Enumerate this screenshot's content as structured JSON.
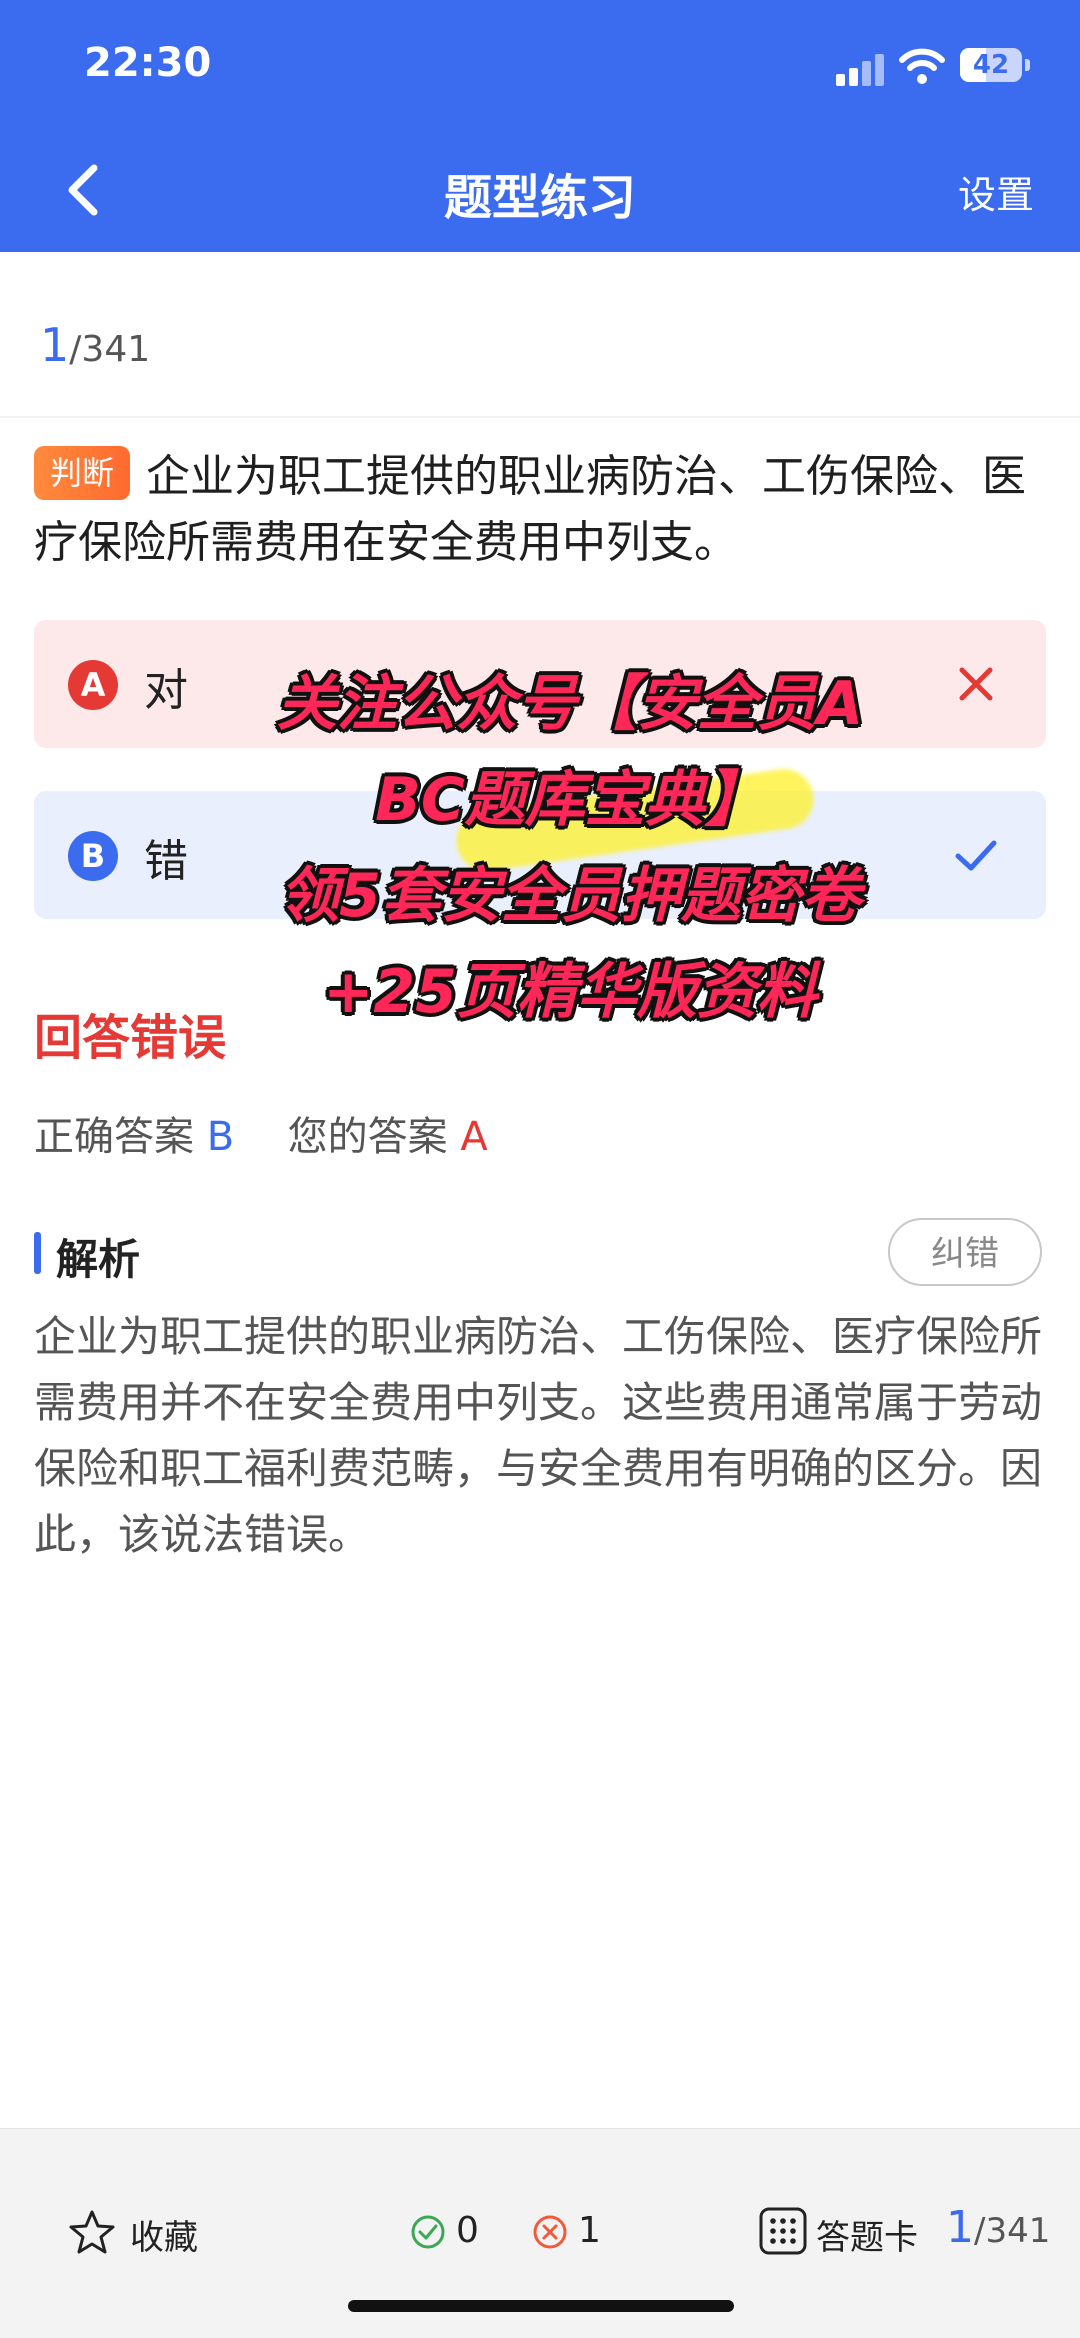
{
  "status_bar": {
    "time": "22:30",
    "battery": "42"
  },
  "nav": {
    "title": "题型练习",
    "settings_label": "设置"
  },
  "progress": {
    "current": "1",
    "total": "/341"
  },
  "question": {
    "tag": "判断",
    "text": "企业为职工提供的职业病防治、工伤保险、医疗保险所需费用在安全费用中列支。"
  },
  "options": [
    {
      "letter": "A",
      "label": "对",
      "state": "wrong"
    },
    {
      "letter": "B",
      "label": "错",
      "state": "correct"
    }
  ],
  "result": {
    "title": "回答错误",
    "correct_label": "正确答案",
    "correct_value": "B",
    "yours_label": "您的答案",
    "yours_value": "A"
  },
  "analysis": {
    "title": "解析",
    "report_label": "纠错",
    "text": "企业为职工提供的职业病防治、工伤保险、医疗保险所需费用并不在安全费用中列支。这些费用通常属于劳动保险和职工福利费范畴，与安全费用有明确的区分。因此，该说法错误。"
  },
  "overlay": {
    "line1": "关注公众号【安全员A",
    "line2": "BC题库宝典】",
    "line3": "领5套安全员押题密卷",
    "line4": "+25页精华版资料"
  },
  "bottom_bar": {
    "favorite_label": "收藏",
    "correct_count": "0",
    "wrong_count": "1",
    "answer_card_label": "答题卡",
    "progress_current": "1",
    "progress_total": "/341"
  },
  "colors": {
    "primary": "#3b6cf0",
    "error": "#e53935",
    "tag": "#ff7a35"
  }
}
